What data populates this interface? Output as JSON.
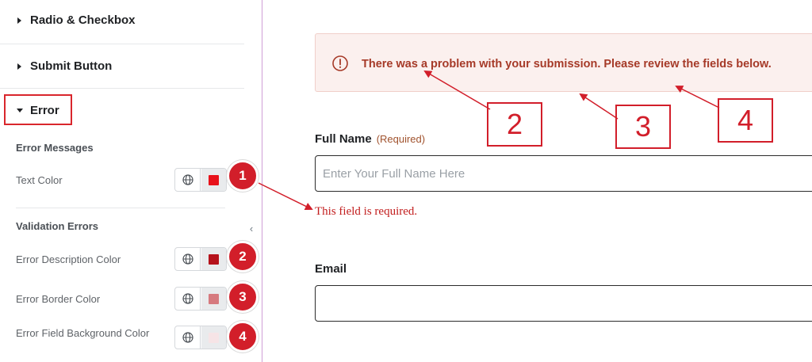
{
  "panel": {
    "sections": {
      "radio_checkbox": "Radio & Checkbox",
      "submit_button": "Submit Button",
      "error": "Error"
    },
    "error_messages": {
      "title": "Error Messages",
      "text_color_label": "Text Color",
      "text_color_swatch": "#e8121b"
    },
    "validation_errors": {
      "title": "Validation Errors",
      "description_color_label": "Error Description Color",
      "description_color_swatch": "#b5121b",
      "border_color_label": "Error Border Color",
      "border_color_swatch": "#d67a7f",
      "background_color_label": "Error Field Background Color",
      "background_color_swatch": "#f6e4e6"
    },
    "icons": {
      "globe": "globe-icon",
      "collapse": "chevron-left-icon"
    }
  },
  "annotations": {
    "badges": [
      "1",
      "2",
      "3",
      "4"
    ],
    "callouts": [
      "2",
      "3",
      "4"
    ],
    "color": "#d21e2a"
  },
  "preview": {
    "alert": {
      "icon": "alert-circle-icon",
      "message": "There was a problem with your submission. Please review the fields below."
    },
    "full_name": {
      "label": "Full Name",
      "required": "(Required)",
      "placeholder": "Enter Your Full Name Here",
      "error": "This field is required."
    },
    "email": {
      "label": "Email",
      "value": ""
    }
  }
}
